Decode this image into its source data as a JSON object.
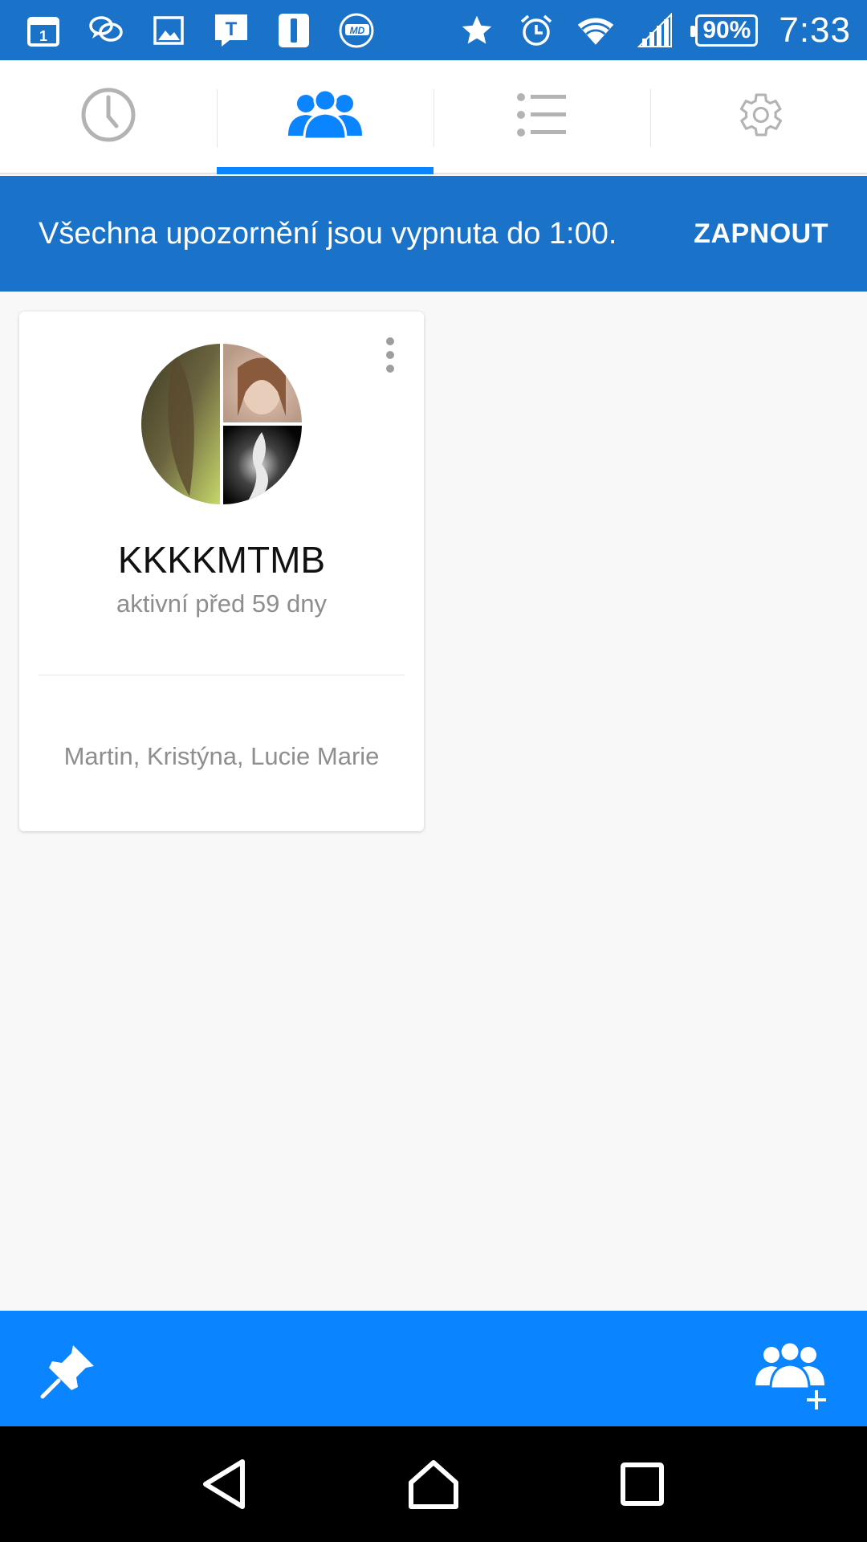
{
  "status_bar": {
    "battery": "90%",
    "time": "7:33",
    "left_icons": [
      "calendar-icon",
      "chat-bubbles-icon",
      "gallery-icon",
      "t-app-icon",
      "i-app-icon",
      "md-app-icon"
    ],
    "right_icons": [
      "star-icon",
      "alarm-icon",
      "wifi-icon",
      "signal-icon",
      "battery-icon"
    ]
  },
  "tabs": [
    {
      "name": "recent",
      "icon": "clock-icon",
      "active": false
    },
    {
      "name": "groups",
      "icon": "people-icon",
      "active": true
    },
    {
      "name": "list",
      "icon": "list-icon",
      "active": false
    },
    {
      "name": "settings",
      "icon": "gear-icon",
      "active": false
    }
  ],
  "banner": {
    "text": "Všechna upozornění jsou vypnuta do 1:00.",
    "action": "ZAPNOUT"
  },
  "group": {
    "name": "KKKKMTMB",
    "activity": "aktivní před 59 dny",
    "members": "Martin, Kristýna, Lucie Marie"
  },
  "action_bar": {
    "left_icon": "pin-icon",
    "right_icon": "add-group-icon"
  },
  "colors": {
    "status_bar": "#1a73c8",
    "banner": "#1a73c8",
    "accent": "#0a84ff",
    "inactive_icon": "#b3b3b3",
    "nav_bar": "#000000"
  }
}
